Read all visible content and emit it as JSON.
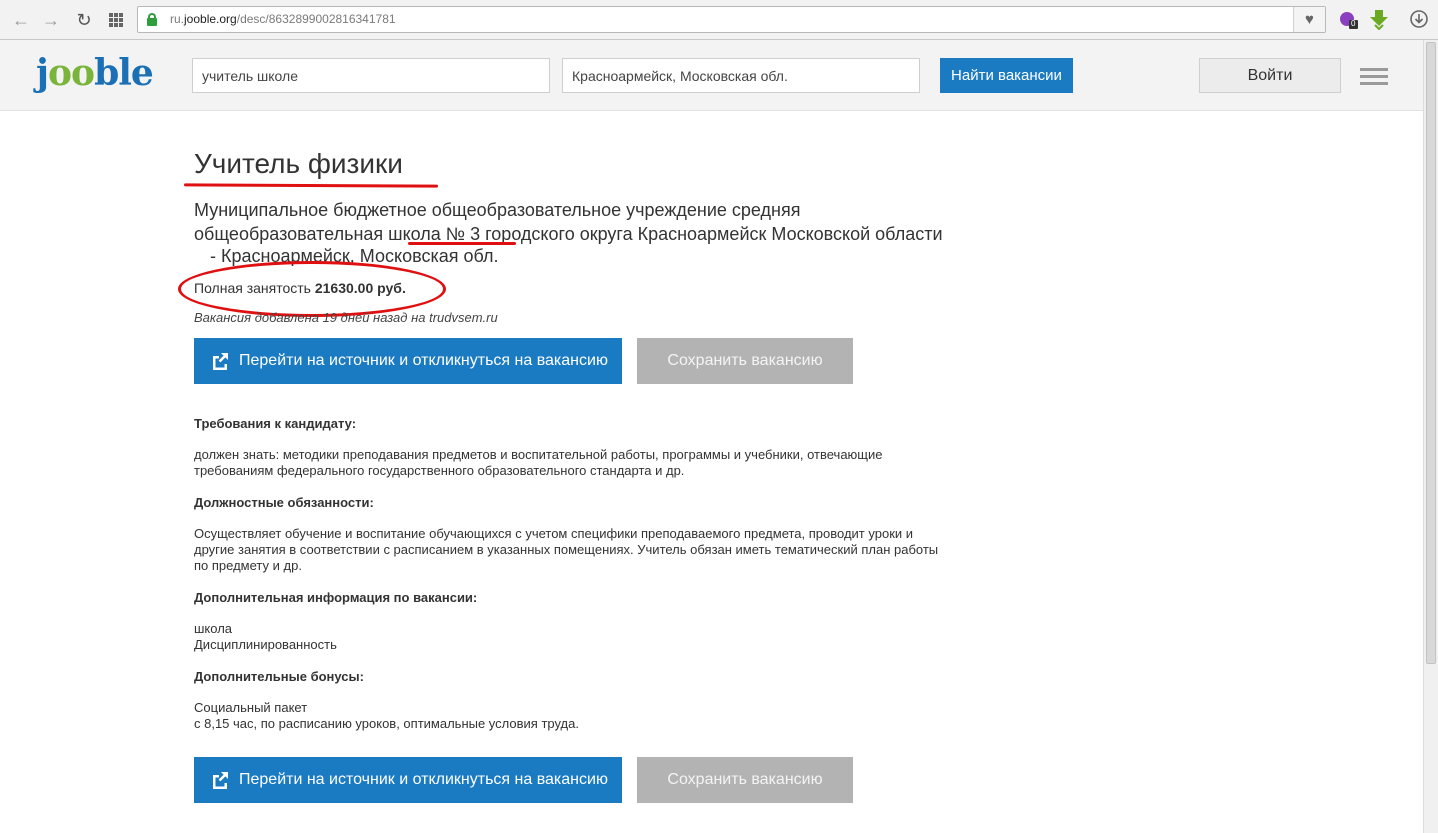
{
  "browser": {
    "url_prefix": "ru.",
    "url_host": "jooble.org",
    "url_path": "/desc/8632899002816341781",
    "badge_count": "0"
  },
  "header": {
    "logo_parts": [
      "j",
      "oo",
      "ble"
    ],
    "search_query": "учитель школе",
    "search_location": "Красноармейск, Московская обл.",
    "find_button": "Найти вакансии",
    "login_button": "Войти"
  },
  "job": {
    "title": "Учитель физики",
    "company_line1": "Муниципальное бюджетное общеобразовательное учреждение средняя",
    "company_line2_pre": "общеобразовательная ",
    "company_line2_mark": "школа № 3",
    "company_line2_post": " городского округа Красноармейск Московской области",
    "location": "-   Красноармейск, Московская обл.",
    "employment": "Полная занятость",
    "salary": "21630.00 руб.",
    "added": "Вакансия добавлена 19 дней назад на trudvsem.ru",
    "apply_button": "Перейти на источник и откликнуться на вакансию",
    "save_button": "Сохранить вакансию"
  },
  "sections": [
    {
      "heading": "Требования к кандидату:",
      "lines": [
        "должен знать: методики преподавания предметов и воспитательной работы, программы и учебники, отвечающие",
        "требованиям федерального государственного образовательного стандарта и др."
      ]
    },
    {
      "heading": "Должностные обязанности:",
      "lines": [
        "Осуществляет обучение и воспитание обучающихся с учетом специфики преподаваемого предмета, проводит уроки и",
        "другие занятия в соответствии с расписанием в указанных помещениях. Учитель обязан иметь тематический план работы",
        "по предмету и др."
      ]
    },
    {
      "heading": "Дополнительная информация по вакансии:",
      "lines": [
        "школа",
        "Дисциплинированность"
      ]
    },
    {
      "heading": "Дополнительные бонусы:",
      "lines": [
        "Социальный пакет",
        "с 8,15 час, по расписанию уроков, оптимальные условия труда."
      ]
    }
  ],
  "colors": {
    "brand_blue": "#1a7bc3",
    "brand_green": "#7ab43b",
    "annotation_red": "#e01010",
    "save_gray": "#b3b3b3"
  },
  "icons": [
    "back-arrow-icon",
    "forward-arrow-icon",
    "reload-icon",
    "apps-grid-icon",
    "lock-icon",
    "heart-icon",
    "extension-icon",
    "download-arrow-icon",
    "download-circle-icon",
    "external-link-icon",
    "hamburger-menu-icon"
  ]
}
